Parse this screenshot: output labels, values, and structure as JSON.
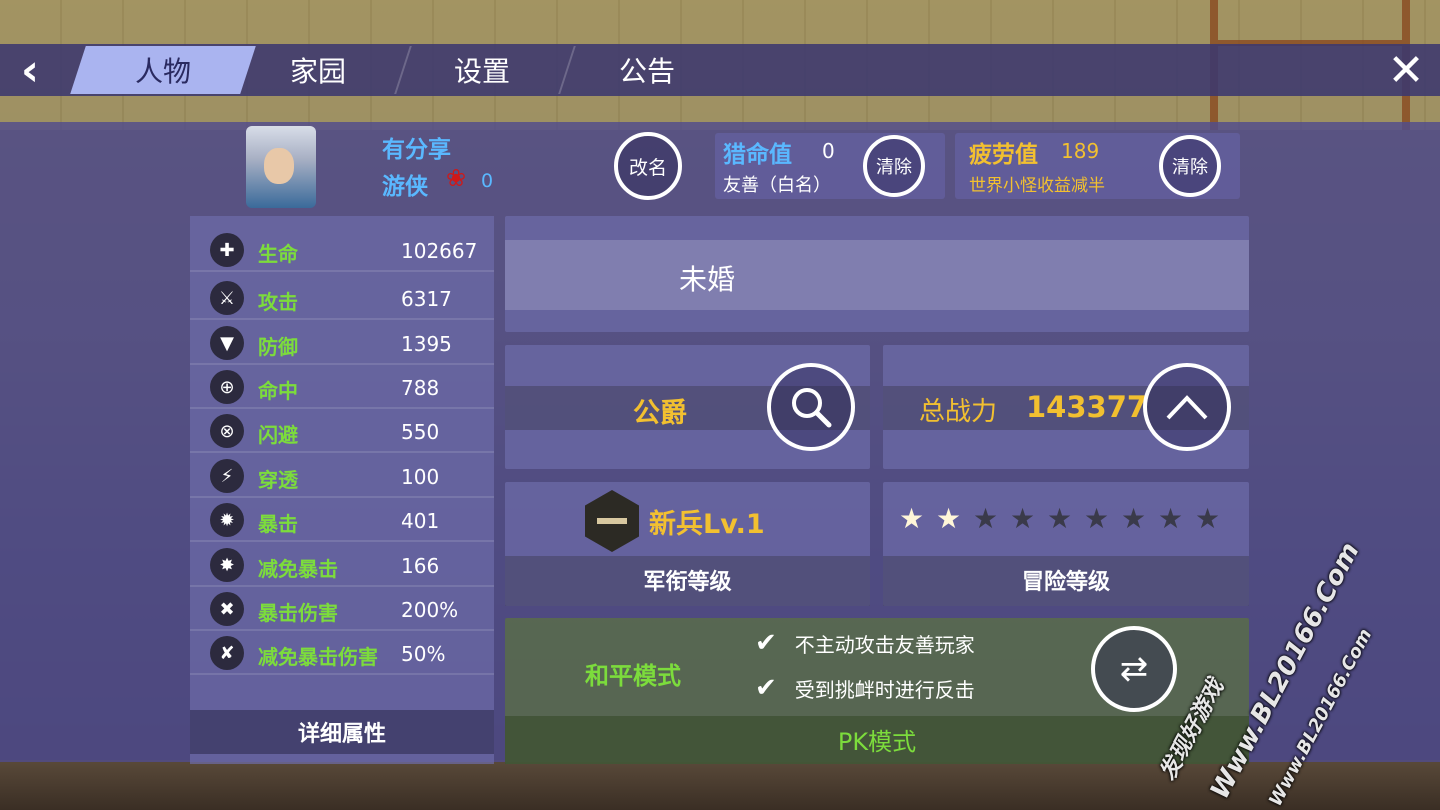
{
  "nav": {
    "back_icon": "chevron-left-icon",
    "tabs": [
      {
        "label": "人物",
        "active": true
      },
      {
        "label": "家园",
        "active": false
      },
      {
        "label": "设置",
        "active": false
      },
      {
        "label": "公告",
        "active": false
      }
    ],
    "close_icon": "close-icon"
  },
  "player": {
    "name": "有分享",
    "class": "游侠",
    "rose_count": "0",
    "rename_label": "改名"
  },
  "hunt": {
    "title": "猎命值",
    "value": "0",
    "status": "友善（白名）",
    "clear_label": "清除"
  },
  "fatigue": {
    "title": "疲劳值",
    "value": "189",
    "note": "世界小怪收益减半",
    "clear_label": "清除"
  },
  "stats": [
    {
      "icon": "plus-icon",
      "label": "生命",
      "value": "102667"
    },
    {
      "icon": "sword-icon",
      "label": "攻击",
      "value": "6317"
    },
    {
      "icon": "shield-icon",
      "label": "防御",
      "value": "1395"
    },
    {
      "icon": "crosshair-icon",
      "label": "命中",
      "value": "788"
    },
    {
      "icon": "dodge-icon",
      "label": "闪避",
      "value": "550"
    },
    {
      "icon": "pierce-icon",
      "label": "穿透",
      "value": "100"
    },
    {
      "icon": "crit-icon",
      "label": "暴击",
      "value": "401"
    },
    {
      "icon": "crit-resist-icon",
      "label": "减免暴击",
      "value": "166"
    },
    {
      "icon": "crossed-swords-icon",
      "label": "暴击伤害",
      "value": "200%"
    },
    {
      "icon": "crossed-swords-reduce-icon",
      "label": "减免暴击伤害",
      "value": "50%"
    }
  ],
  "detail_label": "详细属性",
  "marriage_status": "未婚",
  "title_card": {
    "title": "公爵"
  },
  "power": {
    "label": "总战力",
    "value": "143377"
  },
  "military_rank": {
    "level": "新兵Lv.1",
    "caption": "军衔等级"
  },
  "adventure": {
    "stars_total": 9,
    "stars_filled": 2,
    "caption": "冒险等级"
  },
  "pk": {
    "mode": "和平模式",
    "rules": [
      "不主动攻击友善玩家",
      "受到挑衅时进行反击"
    ],
    "footer": "PK模式"
  },
  "watermark": {
    "site_cn": "发现好游戏",
    "site_url": "Www.BL20166.Com"
  }
}
